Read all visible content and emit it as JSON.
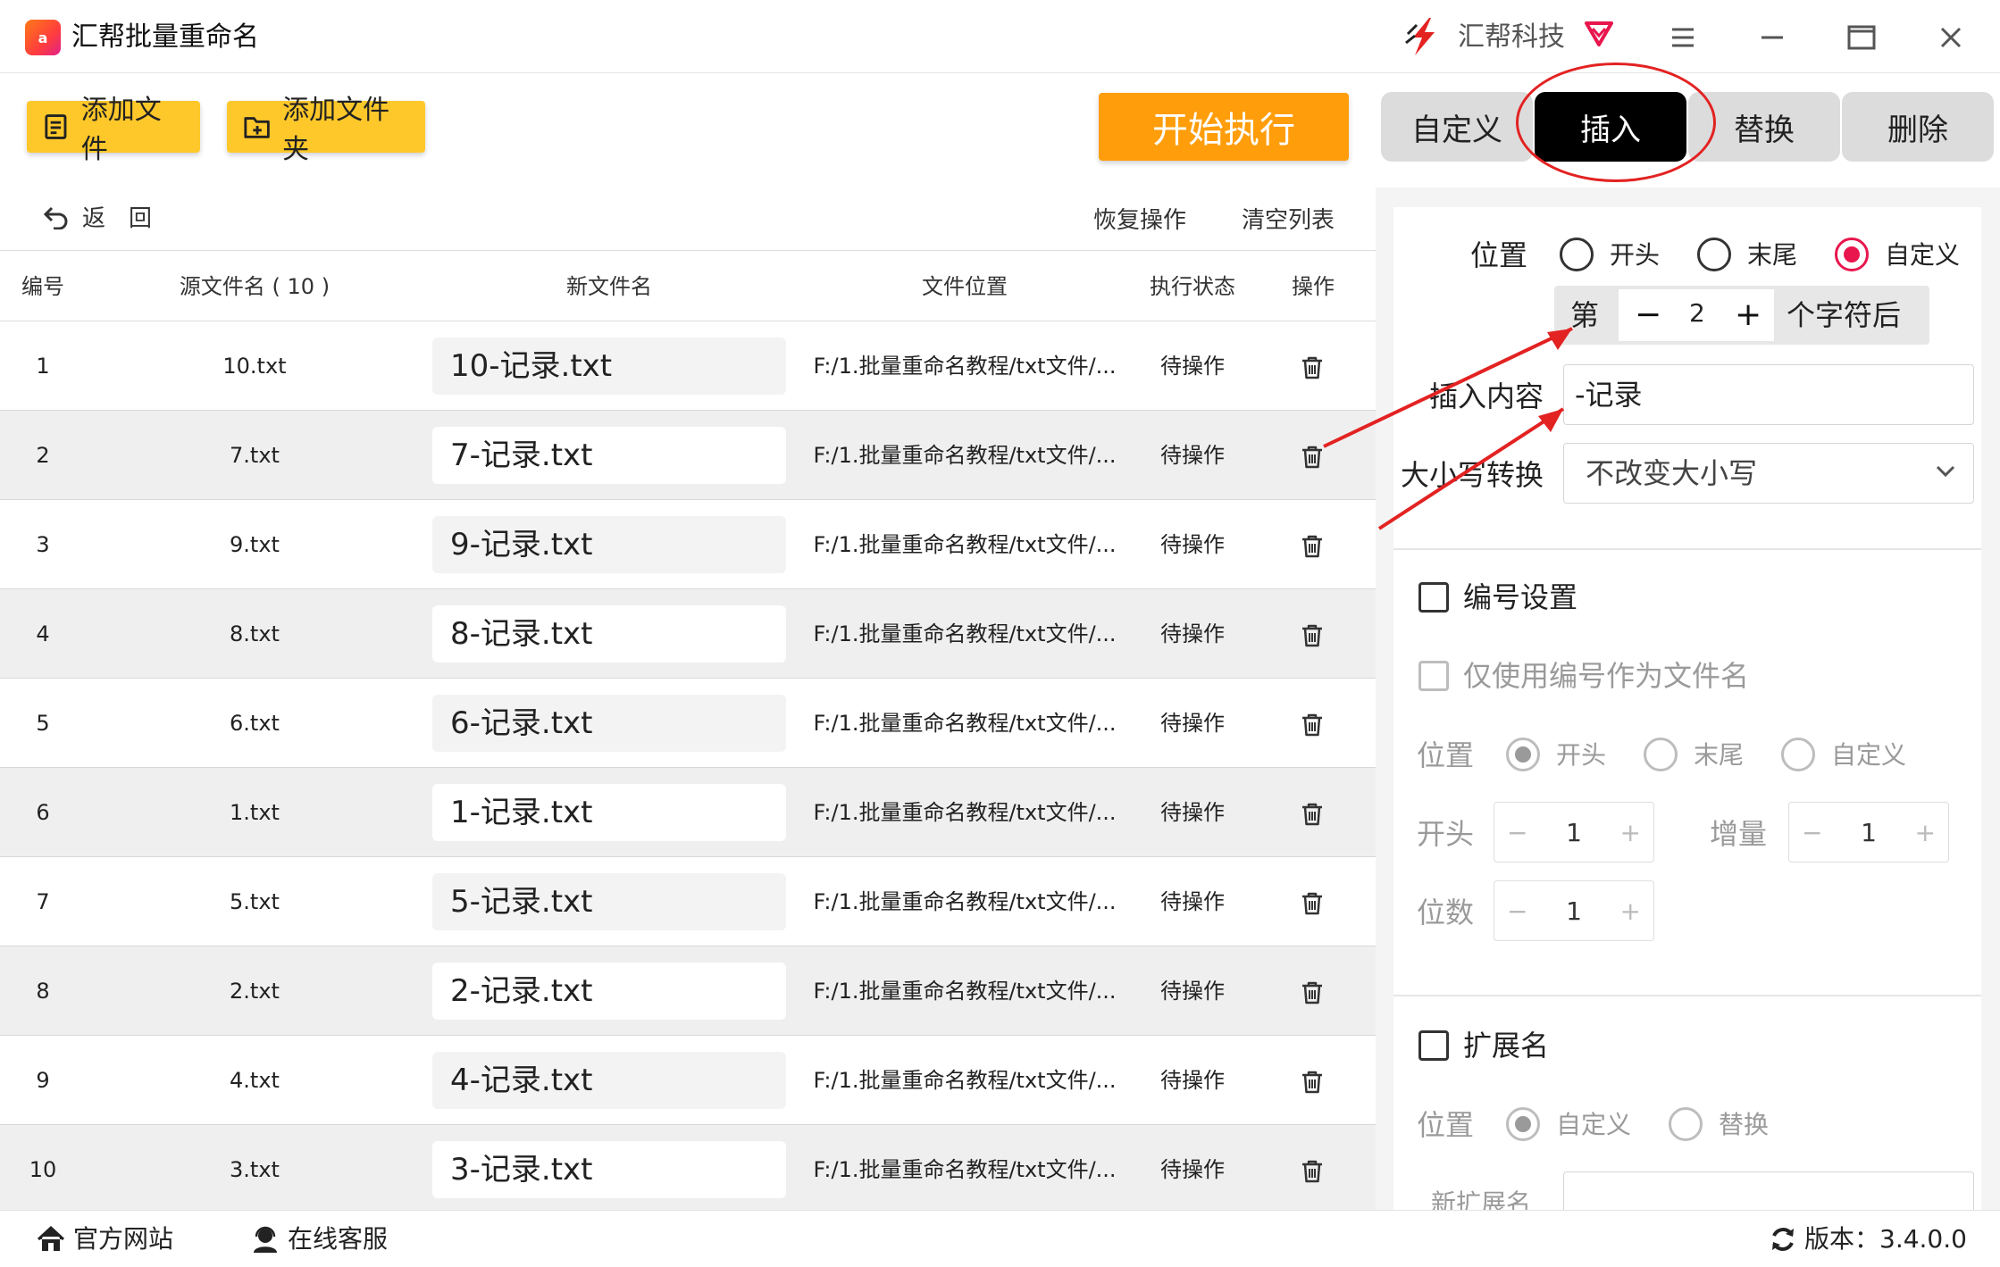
{
  "app": {
    "title": "汇帮批量重命名",
    "logo_text": "a",
    "brand_name": "汇帮科技",
    "window_controls": [
      "menu-icon",
      "minimize-icon",
      "maximize-icon",
      "close-icon"
    ]
  },
  "toolbar": {
    "add_file_label": "添加文件",
    "add_folder_label": "添加文件夹",
    "start_label": "开始执行"
  },
  "mode_tabs": [
    {
      "label": "自定义",
      "active": false
    },
    {
      "label": "插入",
      "active": true
    },
    {
      "label": "替换",
      "active": false
    },
    {
      "label": "删除",
      "active": false
    }
  ],
  "subbar": {
    "back_label": "返　回",
    "restore_label": "恢复操作",
    "clear_label": "清空列表"
  },
  "table": {
    "headers": {
      "index": "编号",
      "source": "源文件名 ( 10 )",
      "newname": "新文件名",
      "location": "文件位置",
      "status": "执行状态",
      "action": "操作"
    },
    "rows": [
      {
        "index": "1",
        "source": "10.txt",
        "newname": "10-记录.txt",
        "location": "F:/1.批量重命名教程/txt文件/...",
        "status": "待操作"
      },
      {
        "index": "2",
        "source": "7.txt",
        "newname": "7-记录.txt",
        "location": "F:/1.批量重命名教程/txt文件/...",
        "status": "待操作"
      },
      {
        "index": "3",
        "source": "9.txt",
        "newname": "9-记录.txt",
        "location": "F:/1.批量重命名教程/txt文件/...",
        "status": "待操作"
      },
      {
        "index": "4",
        "source": "8.txt",
        "newname": "8-记录.txt",
        "location": "F:/1.批量重命名教程/txt文件/...",
        "status": "待操作"
      },
      {
        "index": "5",
        "source": "6.txt",
        "newname": "6-记录.txt",
        "location": "F:/1.批量重命名教程/txt文件/...",
        "status": "待操作"
      },
      {
        "index": "6",
        "source": "1.txt",
        "newname": "1-记录.txt",
        "location": "F:/1.批量重命名教程/txt文件/...",
        "status": "待操作"
      },
      {
        "index": "7",
        "source": "5.txt",
        "newname": "5-记录.txt",
        "location": "F:/1.批量重命名教程/txt文件/...",
        "status": "待操作"
      },
      {
        "index": "8",
        "source": "2.txt",
        "newname": "2-记录.txt",
        "location": "F:/1.批量重命名教程/txt文件/...",
        "status": "待操作"
      },
      {
        "index": "9",
        "source": "4.txt",
        "newname": "4-记录.txt",
        "location": "F:/1.批量重命名教程/txt文件/...",
        "status": "待操作"
      },
      {
        "index": "10",
        "source": "3.txt",
        "newname": "3-记录.txt",
        "location": "F:/1.批量重命名教程/txt文件/...",
        "status": "待操作"
      }
    ]
  },
  "insert_panel": {
    "position_label": "位置",
    "pos_start": "开头",
    "pos_end": "末尾",
    "pos_custom": "自定义",
    "selected_position": "自定义",
    "nth_prefix": "第",
    "nth_value": "2",
    "nth_suffix": "个字符后",
    "content_label": "插入内容",
    "content_value": "-记录",
    "case_label": "大小写转换",
    "case_value": "不改变大小写"
  },
  "numbering": {
    "title": "编号设置",
    "only_number_label": "仅使用编号作为文件名",
    "position_label": "位置",
    "pos_start": "开头",
    "pos_end": "末尾",
    "pos_custom": "自定义",
    "start_label": "开头",
    "start_value": "1",
    "increment_label": "增量",
    "increment_value": "1",
    "digits_label": "位数",
    "digits_value": "1"
  },
  "extension": {
    "title": "扩展名",
    "position_label": "位置",
    "pos_custom": "自定义",
    "pos_replace": "替换",
    "new_ext_label": "新扩展名"
  },
  "footer": {
    "website_label": "官方网站",
    "support_label": "在线客服",
    "version_label": "版本：3.4.0.0"
  },
  "colors": {
    "accent_yellow": "#ffc82a",
    "start_orange": "#ff9d0b",
    "radio_pink": "#e8164d",
    "annotation_red": "#e32222"
  }
}
